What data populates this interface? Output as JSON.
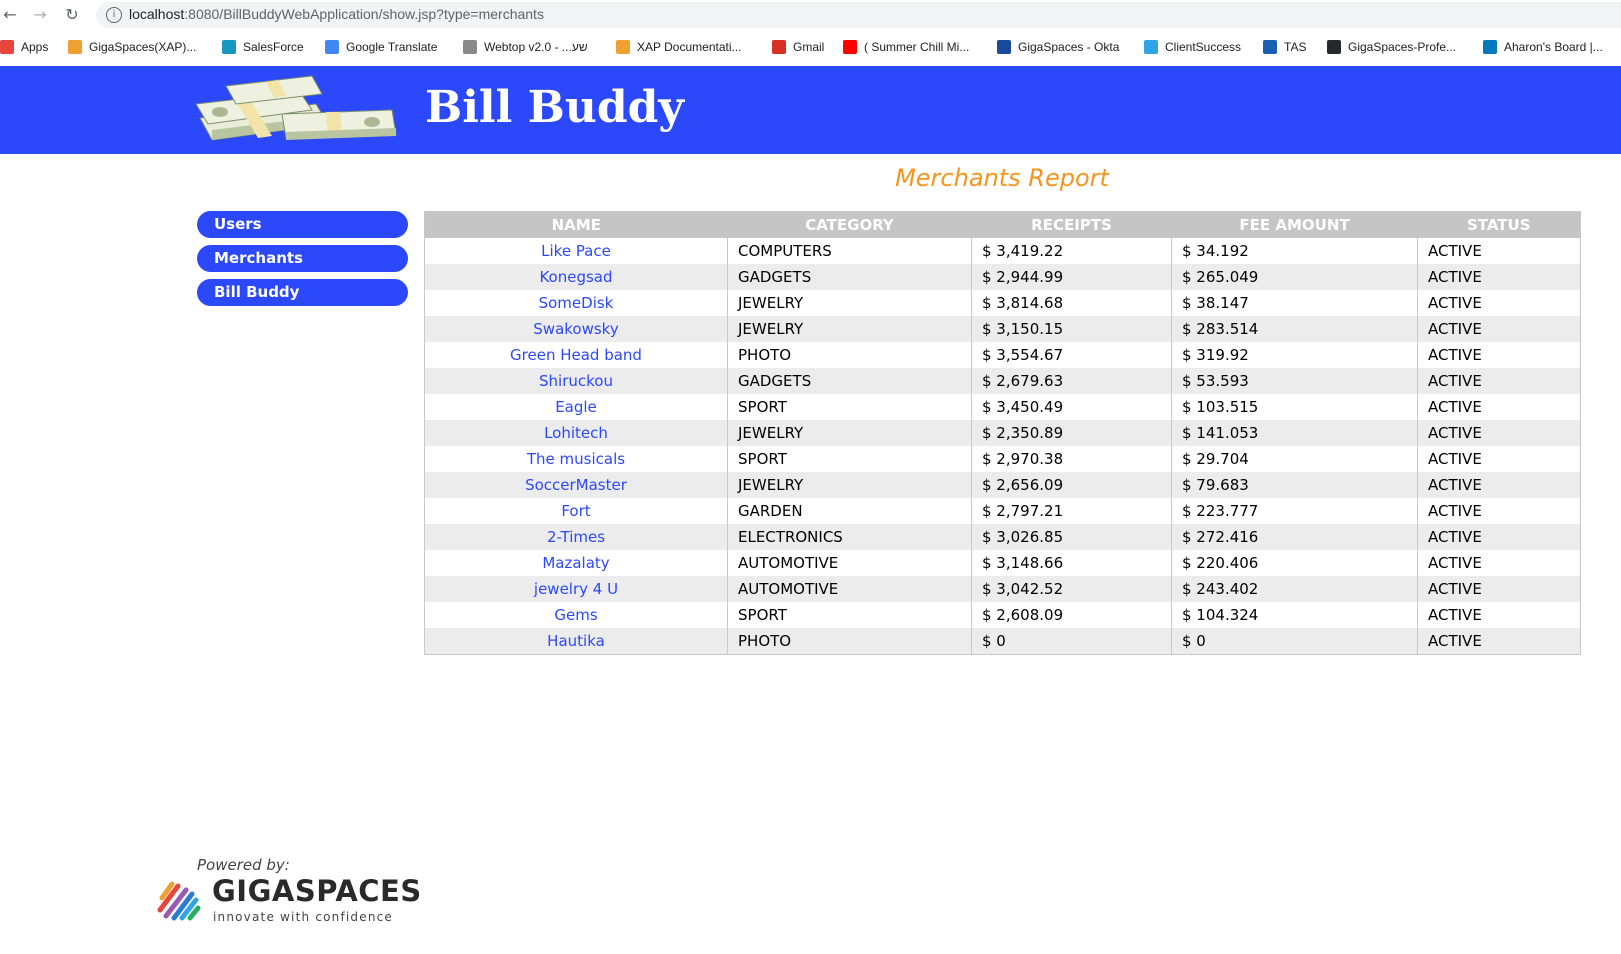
{
  "browser": {
    "url_host": "localhost",
    "url_path": ":8080/BillBuddyWebApplication/show.jsp?type=merchants",
    "bookmarks": [
      {
        "label": "Apps",
        "icon": "apps-grid-icon",
        "color": "#e8453c"
      },
      {
        "label": "GigaSpaces(XAP)...",
        "icon": "gigaspaces-icon",
        "color": "#f0a030"
      },
      {
        "label": "SalesForce",
        "icon": "salesforce-cloud-icon",
        "color": "#1798c1"
      },
      {
        "label": "Google Translate",
        "icon": "google-translate-icon",
        "color": "#4285f4"
      },
      {
        "label": "Webtop v2.0 - ...שע",
        "icon": "webtop-icon",
        "color": "#888888"
      },
      {
        "label": "XAP Documentati...",
        "icon": "gigaspaces-icon",
        "color": "#f0a030"
      },
      {
        "label": "Gmail",
        "icon": "gmail-icon",
        "color": "#d93025"
      },
      {
        "label": "( Summer Chill Mi...",
        "icon": "youtube-icon",
        "color": "#ff0000"
      },
      {
        "label": "GigaSpaces - Okta",
        "icon": "okta-icon",
        "color": "#1a4a9c"
      },
      {
        "label": "ClientSuccess",
        "icon": "clientsuccess-icon",
        "color": "#2fa4e7"
      },
      {
        "label": "TAS",
        "icon": "globe-icon",
        "color": "#1a5fb4"
      },
      {
        "label": "GigaSpaces-Profe...",
        "icon": "github-icon",
        "color": "#24292e"
      },
      {
        "label": "Aharon's Board |...",
        "icon": "trello-icon",
        "color": "#0079bf"
      }
    ]
  },
  "header": {
    "title": "Bill Buddy",
    "bg_color": "#2b48fb"
  },
  "report": {
    "title": "Merchants Report",
    "title_color": "#f7941d"
  },
  "sidebar": {
    "items": [
      {
        "label": "Users"
      },
      {
        "label": "Merchants"
      },
      {
        "label": "Bill Buddy"
      }
    ]
  },
  "table": {
    "columns": [
      "NAME",
      "CATEGORY",
      "RECEIPTS",
      "FEE AMOUNT",
      "STATUS"
    ],
    "rows": [
      {
        "name": "Like Pace",
        "category": "COMPUTERS",
        "receipts": "$ 3,419.22",
        "fee": "$ 34.192",
        "status": "ACTIVE"
      },
      {
        "name": "Konegsad",
        "category": "GADGETS",
        "receipts": "$ 2,944.99",
        "fee": "$ 265.049",
        "status": "ACTIVE"
      },
      {
        "name": "SomeDisk",
        "category": "JEWELRY",
        "receipts": "$ 3,814.68",
        "fee": "$ 38.147",
        "status": "ACTIVE"
      },
      {
        "name": "Swakowsky",
        "category": "JEWELRY",
        "receipts": "$ 3,150.15",
        "fee": "$ 283.514",
        "status": "ACTIVE"
      },
      {
        "name": "Green Head band",
        "category": "PHOTO",
        "receipts": "$ 3,554.67",
        "fee": "$ 319.92",
        "status": "ACTIVE"
      },
      {
        "name": "Shiruckou",
        "category": "GADGETS",
        "receipts": "$ 2,679.63",
        "fee": "$ 53.593",
        "status": "ACTIVE"
      },
      {
        "name": "Eagle",
        "category": "SPORT",
        "receipts": "$ 3,450.49",
        "fee": "$ 103.515",
        "status": "ACTIVE"
      },
      {
        "name": "Lohitech",
        "category": "JEWELRY",
        "receipts": "$ 2,350.89",
        "fee": "$ 141.053",
        "status": "ACTIVE"
      },
      {
        "name": "The musicals",
        "category": "SPORT",
        "receipts": "$ 2,970.38",
        "fee": "$ 29.704",
        "status": "ACTIVE"
      },
      {
        "name": "SoccerMaster",
        "category": "JEWELRY",
        "receipts": "$ 2,656.09",
        "fee": "$ 79.683",
        "status": "ACTIVE"
      },
      {
        "name": "Fort",
        "category": "GARDEN",
        "receipts": "$ 2,797.21",
        "fee": "$ 223.777",
        "status": "ACTIVE"
      },
      {
        "name": "2-Times",
        "category": "ELECTRONICS",
        "receipts": "$ 3,026.85",
        "fee": "$ 272.416",
        "status": "ACTIVE"
      },
      {
        "name": "Mazalaty",
        "category": "AUTOMOTIVE",
        "receipts": "$ 3,148.66",
        "fee": "$ 220.406",
        "status": "ACTIVE"
      },
      {
        "name": "jewelry 4 U",
        "category": "AUTOMOTIVE",
        "receipts": "$ 3,042.52",
        "fee": "$ 243.402",
        "status": "ACTIVE"
      },
      {
        "name": "Gems",
        "category": "SPORT",
        "receipts": "$ 2,608.09",
        "fee": "$ 104.324",
        "status": "ACTIVE"
      },
      {
        "name": "Hautika",
        "category": "PHOTO",
        "receipts": "$ 0",
        "fee": "$ 0",
        "status": "ACTIVE"
      }
    ]
  },
  "footer": {
    "powered_by": "Powered by:",
    "brand": "GIGASPACES",
    "tagline": "innovate with confidence"
  }
}
